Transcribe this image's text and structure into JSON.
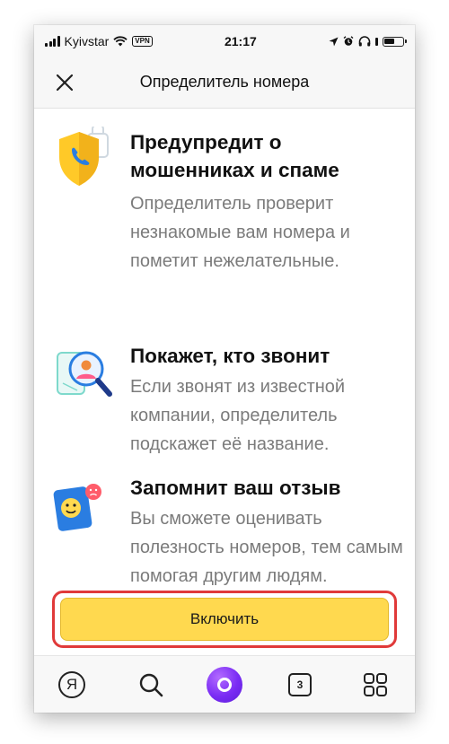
{
  "status_bar": {
    "carrier": "Kyivstar",
    "vpn": "VPN",
    "time": "21:17",
    "icons": [
      "signal-icon",
      "wifi-icon",
      "vpn-badge",
      "location-icon",
      "alarm-icon",
      "headphones-icon",
      "battery-icon"
    ]
  },
  "header": {
    "title": "Определитель номера",
    "close_icon": "close-icon"
  },
  "features": [
    {
      "icon": "shield-phone-icon",
      "title": "Предупредит о мошенниках и спаме",
      "description": "Определитель проверит незнакомые вам номера и пометит нежелательные."
    },
    {
      "icon": "magnifier-contact-icon",
      "title": "Покажет, кто звонит",
      "description": "Если звонят из известной компании, определитель подскажет её название."
    },
    {
      "icon": "feedback-faces-icon",
      "title": "Запомнит ваш отзыв",
      "description": "Вы сможете оценивать полезность номеров, тем самым помогая другим людям."
    }
  ],
  "cta": {
    "label": "Включить"
  },
  "tab_bar": {
    "yandex_label": "Я",
    "tabs_count": "3",
    "icons": [
      "yandex-icon",
      "search-icon",
      "alice-icon",
      "tabs-icon",
      "services-grid-icon"
    ]
  },
  "colors": {
    "cta_fill": "#ffd94f",
    "highlight_border": "#e03a3a",
    "alice_purple": "#7a2cf4",
    "description_gray": "#7b7b7b"
  }
}
